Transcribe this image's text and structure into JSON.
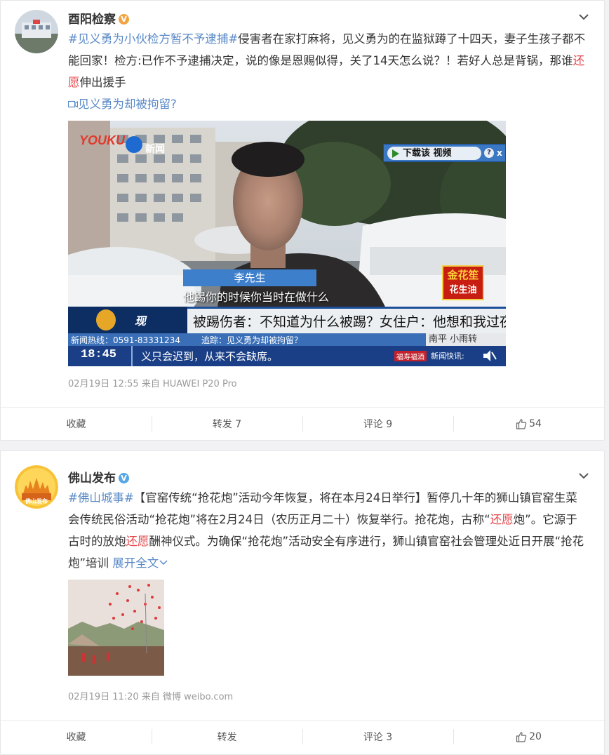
{
  "posts": [
    {
      "username": "酉阳检察",
      "verified_badge": "V",
      "text_parts": [
        {
          "t": "#见义勇为小伙检方暂不予逮捕#",
          "k": "tag"
        },
        {
          "t": "侵害者在家打麻将，见义勇为的在监狱蹲了十四天，妻子生孩子都不能回家！检方:已作不予逮捕决定，说的像是恩赐似得，关了14天怎么说？！若好人总是背锅，那谁",
          "k": "plain"
        },
        {
          "t": "还愿",
          "k": "hl"
        },
        {
          "t": "伸出援手",
          "k": "plain"
        }
      ],
      "video_link": "见义勇为却被拘留?",
      "video": {
        "logo_youku": "YOUKU",
        "logo_news": "新闻",
        "download_btn": "下载该 视频",
        "download_help": "?",
        "download_close": "x",
        "name_tag": "李先生",
        "subtitle": "他踢你的时候你当时在做什么",
        "headline": "被踢伤者：不知道为什么被踢？女住户：他想和我过夜",
        "hotline": "新闻热线：0591-83331234",
        "follow": "追踪：见义勇为却被拘留？",
        "time": "18:45",
        "ticker": "义只会迟到，从来不会缺席。",
        "sponsor_top": "金花笙",
        "sponsor_bottom": "花生油",
        "ticker_right_1": "南平  小雨转",
        "ticker_brand": "福寿福酒",
        "ticker_news": "新闻快讯:",
        "scene_logo": "现"
      },
      "meta": "02月19日 12:55 来自 HUAWEI P20 Pro",
      "actions": {
        "fav": "收藏",
        "repost": "转发 7",
        "comment": "评论 9",
        "like": "54"
      }
    },
    {
      "username": "佛山发布",
      "verified_badge": "V",
      "avatar_label": "佛山发布",
      "text_parts": [
        {
          "t": "#佛山城事#",
          "k": "tag"
        },
        {
          "t": "【官窑传统“抢花炮”活动今年恢复，将在本月24日举行】暂停几十年的狮山镇官窑生菜会传统民俗活动“抢花炮”将在2月24日（农历正月二十）恢复举行。抢花炮，古称“",
          "k": "plain"
        },
        {
          "t": "还愿",
          "k": "hl"
        },
        {
          "t": "炮”。它源于古时的放炮",
          "k": "plain"
        },
        {
          "t": "还愿",
          "k": "hl"
        },
        {
          "t": "酬神仪式。为确保“抢花炮”活动安全有序进行，狮山镇官窑社会管理处近日开展“抢花炮”培训 ",
          "k": "plain"
        },
        {
          "t": "展开全文",
          "k": "more"
        }
      ],
      "meta": "02月19日 11:20 来自 微博 weibo.com",
      "actions": {
        "fav": "收藏",
        "repost": "转发",
        "comment": "评论 3",
        "like": "20"
      }
    }
  ],
  "colors": {
    "link": "#5a8ac7",
    "highlight": "#e5474b",
    "meta": "#999999",
    "background": "#f2f2f5"
  }
}
